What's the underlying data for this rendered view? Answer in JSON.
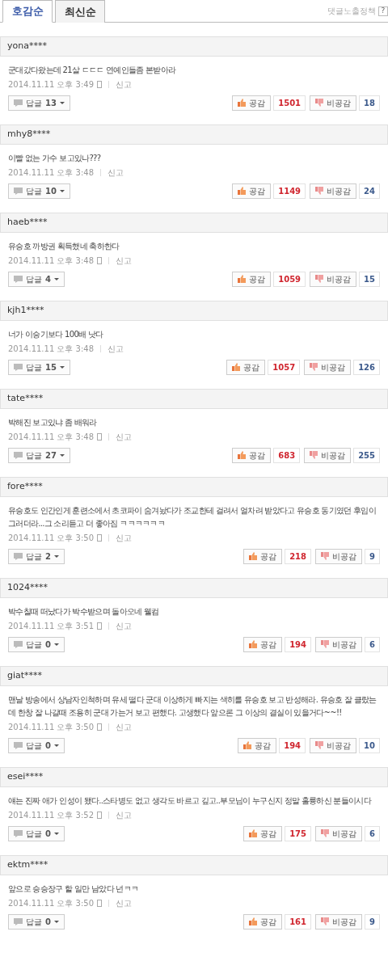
{
  "tabs": [
    {
      "label": "호감순",
      "selected": true
    },
    {
      "label": "최신순",
      "selected": false
    }
  ],
  "policy_link": {
    "label": "댓글노출정책",
    "help": "?"
  },
  "comments": [
    {
      "user": "yona****",
      "text": "군대갔다왔는데 21살 ㄷㄷㄷ 연예인들좀 본받아라",
      "date": "2014.11.11 오후 3:49",
      "mobile": true,
      "report": "신고",
      "reply_label": "답글",
      "reply_count": "13",
      "like_label": "공감",
      "likes": "1501",
      "dislike_label": "비공감",
      "dislikes": "18"
    },
    {
      "user": "mhy8****",
      "text": "이빨 없는 가수 보고있나???",
      "date": "2014.11.11 오후 3:48",
      "mobile": false,
      "report": "신고",
      "reply_label": "답글",
      "reply_count": "10",
      "like_label": "공감",
      "likes": "1149",
      "dislike_label": "비공감",
      "dislikes": "24"
    },
    {
      "user": "haeb****",
      "text": "유승호 까방권 획득했네 축하한다",
      "date": "2014.11.11 오후 3:48",
      "mobile": true,
      "report": "신고",
      "reply_label": "답글",
      "reply_count": "4",
      "like_label": "공감",
      "likes": "1059",
      "dislike_label": "비공감",
      "dislikes": "15"
    },
    {
      "user": "kjh1****",
      "text": "너가 이승기보다 100배 낫다",
      "date": "2014.11.11 오후 3:48",
      "mobile": false,
      "report": "신고",
      "reply_label": "답글",
      "reply_count": "15",
      "like_label": "공감",
      "likes": "1057",
      "dislike_label": "비공감",
      "dislikes": "126"
    },
    {
      "user": "tate****",
      "text": "박해진 보고있냐 좀 배워라",
      "date": "2014.11.11 오후 3:48",
      "mobile": true,
      "report": "신고",
      "reply_label": "답글",
      "reply_count": "27",
      "like_label": "공감",
      "likes": "683",
      "dislike_label": "비공감",
      "dislikes": "255"
    },
    {
      "user": "fore****",
      "text": "유승호도 인간인게 훈련소에서 초코파이 숨겨놨다가 조교한테 걸려서 얼차려 받았다고 유승호 동기였던 후임이 그러더라...그 소리듣고 더 좋아짐 ㅋㅋㅋㅋㅋㅋ",
      "date": "2014.11.11 오후 3:50",
      "mobile": true,
      "report": "신고",
      "reply_label": "답글",
      "reply_count": "2",
      "like_label": "공감",
      "likes": "218",
      "dislike_label": "비공감",
      "dislikes": "9"
    },
    {
      "user": "1024****",
      "text": "박수칠때 떠났다가 박수받으며 돌아오네 웰컴",
      "date": "2014.11.11 오후 3:51",
      "mobile": true,
      "report": "신고",
      "reply_label": "답글",
      "reply_count": "0",
      "like_label": "공감",
      "likes": "194",
      "dislike_label": "비공감",
      "dislikes": "6"
    },
    {
      "user": "giat****",
      "text": "맨날 방송에서 상남자인척하며 유세 떨다 군대 이상하게 빠지는 색히를 유승호 보고 반성해라. 유승호 잘 클랐는데 한창 잘 나갈때 조용히 군대 가는거 보고 편했다. 고생했다 앞으론 그 이상의 결실이 있을거다~~!!",
      "date": "2014.11.11 오후 3:50",
      "mobile": true,
      "report": "신고",
      "reply_label": "답글",
      "reply_count": "0",
      "like_label": "공감",
      "likes": "194",
      "dislike_label": "비공감",
      "dislikes": "10"
    },
    {
      "user": "esei****",
      "text": "얘는 진짜 애가 인성이 됐다..스타병도 없고 생각도 바르고 깊고..부모님이 누구신지 정말 훌륭하신 분들이시다",
      "date": "2014.11.11 오후 3:52",
      "mobile": true,
      "report": "신고",
      "reply_label": "답글",
      "reply_count": "0",
      "like_label": "공감",
      "likes": "175",
      "dislike_label": "비공감",
      "dislikes": "6"
    },
    {
      "user": "ektm****",
      "text": "앞으로 승승장구 할 일만 남았다 넌ㅋㅋ",
      "date": "2014.11.11 오후 3:50",
      "mobile": true,
      "report": "신고",
      "reply_label": "답글",
      "reply_count": "0",
      "like_label": "공감",
      "likes": "161",
      "dislike_label": "비공감",
      "dislikes": "9"
    }
  ]
}
